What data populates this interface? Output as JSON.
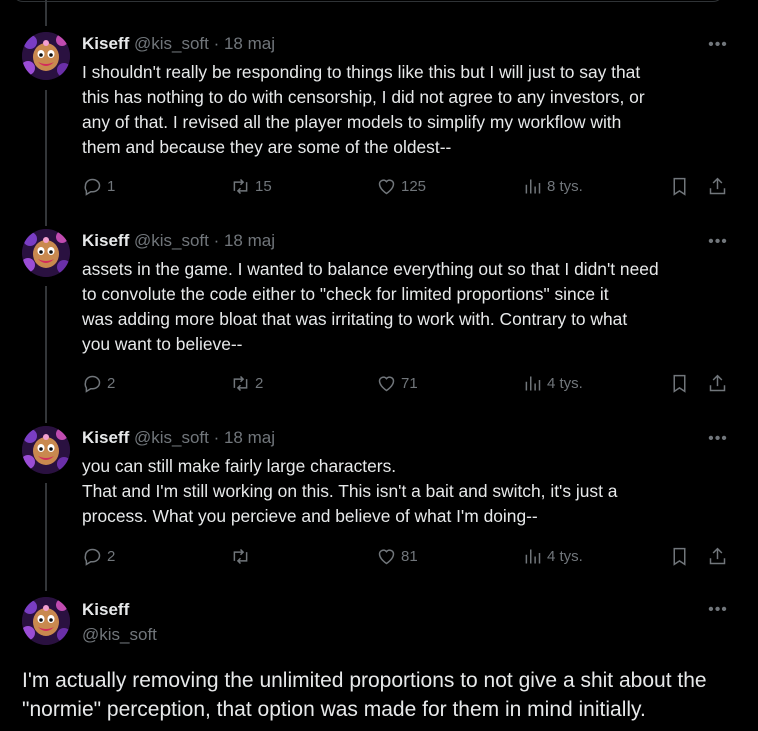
{
  "tweets": [
    {
      "name": "Kiseff",
      "meta": "@kis_soft · 18 maj",
      "text": "I shouldn't really be responding to things like this but I will just to say that\nthis has nothing to do with censorship, I did not agree to any investors, or\nany of that. I revised all the player models to simplify my workflow with\nthem and because they are some of the oldest--",
      "replies": "1",
      "reposts": "15",
      "likes": "125",
      "views": "8 tys."
    },
    {
      "name": "Kiseff",
      "meta": "@kis_soft · 18 maj",
      "text": "assets in the game. I wanted to balance everything out so that I didn't need\nto convolute the code either to \"check for limited proportions\" since it\nwas adding more bloat that was irritating to work with. Contrary to what\nyou want to believe--",
      "replies": "2",
      "reposts": "2",
      "likes": "71",
      "views": "4 tys."
    },
    {
      "name": "Kiseff",
      "meta": "@kis_soft · 18 maj",
      "text": "you can still make fairly large characters.\nThat and I'm still working on this. This isn't a bait and switch, it's just a\nprocess. What you percieve and believe of what I'm doing--",
      "replies": "2",
      "reposts": "",
      "likes": "81",
      "views": "4 tys."
    }
  ],
  "focus": {
    "name": "Kiseff",
    "handle": "@kis_soft",
    "text": "I'm actually removing the unlimited proportions to not give a shit about the \"normie\" perception, that option was made for them in mind initially."
  },
  "more_glyph": "•••",
  "colors": {
    "background": "#000000",
    "text": "#e7e9ea",
    "muted": "#71767b",
    "line": "#333639"
  }
}
